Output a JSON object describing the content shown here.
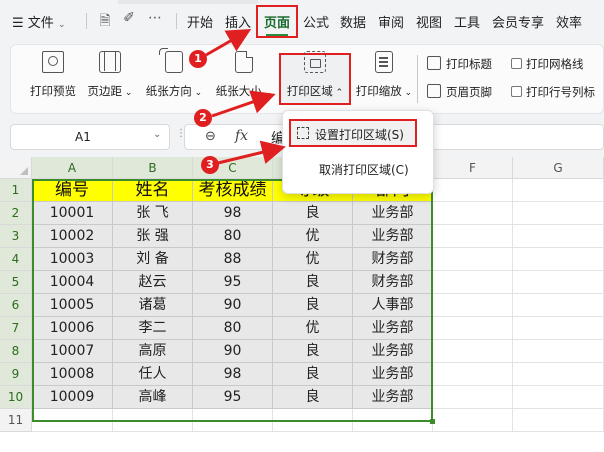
{
  "menubar": {
    "file_icon": "menu-lines-icon",
    "file_label": "文件",
    "tabs": [
      "开始",
      "插入",
      "页面",
      "公式",
      "数据",
      "审阅",
      "视图",
      "工具",
      "会员专享",
      "效率"
    ],
    "active_tab": "页面"
  },
  "ribbon": {
    "print_preview": "打印预览",
    "margins": "页边距",
    "orientation": "纸张方向",
    "size": "纸张大小",
    "print_area": "打印区域",
    "print_scale": "打印缩放",
    "print_titles": "打印标题",
    "header_footer": "页眉页脚",
    "print_gridlines": "打印网格线",
    "print_row_col": "打印行号列标"
  },
  "dropdown": {
    "set_print_area": "设置打印区域(S)",
    "cancel_print_area": "取消打印区域(C)"
  },
  "formula_bar": {
    "cell_ref": "A1",
    "fx_label": "fx",
    "content_partial": "编"
  },
  "annotations": {
    "badge1": "1",
    "badge2": "2",
    "badge3": "3",
    "color": "#e02020"
  },
  "grid": {
    "columns": [
      "A",
      "B",
      "C",
      "D",
      "E",
      "F",
      "G"
    ],
    "rows": [
      "1",
      "2",
      "3",
      "4",
      "5",
      "6",
      "7",
      "8",
      "9",
      "10",
      "11"
    ],
    "header": [
      "编号",
      "姓名",
      "考核成绩",
      "等级",
      "部门"
    ],
    "data": [
      [
        "10001",
        "张 飞",
        "98",
        "良",
        "业务部"
      ],
      [
        "10002",
        "张 强",
        "80",
        "优",
        "业务部"
      ],
      [
        "10003",
        "刘 备",
        "88",
        "优",
        "财务部"
      ],
      [
        "10004",
        "赵云",
        "95",
        "良",
        "财务部"
      ],
      [
        "10005",
        "诸葛",
        "90",
        "良",
        "人事部"
      ],
      [
        "10006",
        "李二",
        "80",
        "优",
        "业务部"
      ],
      [
        "10007",
        "高原",
        "90",
        "良",
        "业务部"
      ],
      [
        "10008",
        "任人",
        "98",
        "良",
        "业务部"
      ],
      [
        "10009",
        "高峰",
        "95",
        "良",
        "业务部"
      ]
    ],
    "header_bg": "#ffff00",
    "body_bg": "#e8e8e8",
    "selection_color": "#3d8c2c"
  }
}
